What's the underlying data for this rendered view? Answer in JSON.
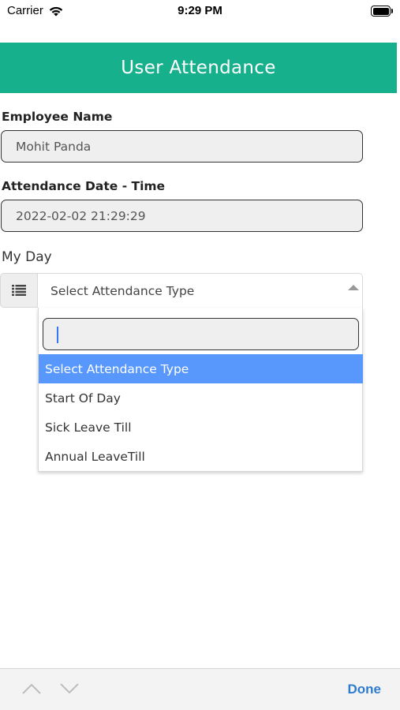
{
  "status_bar": {
    "carrier": "Carrier",
    "time": "9:29 PM",
    "icons": [
      "wifi-icon",
      "battery-icon"
    ]
  },
  "header": {
    "title": "User Attendance",
    "color": "#17b08d"
  },
  "form": {
    "employee_name": {
      "label": "Employee Name",
      "value": "Mohit Panda"
    },
    "attendance_datetime": {
      "label": "Attendance Date - Time",
      "value": "2022-02-02 21:29:29"
    },
    "my_day": {
      "label": "My Day",
      "addon_icon": "list-icon",
      "selected_value": "Select Attendance Type",
      "search_value": "",
      "options": [
        "Select Attendance Type",
        "Start Of Day",
        "Sick Leave Till",
        "Annual LeaveTill"
      ],
      "highlighted_option": "Select Attendance Type",
      "highlight_color": "#5897fb"
    }
  },
  "keyboard_toolbar": {
    "prev_icon": "chevron-up-icon",
    "next_icon": "chevron-down-icon",
    "done_label": "Done",
    "done_color": "#2f7ccf"
  }
}
